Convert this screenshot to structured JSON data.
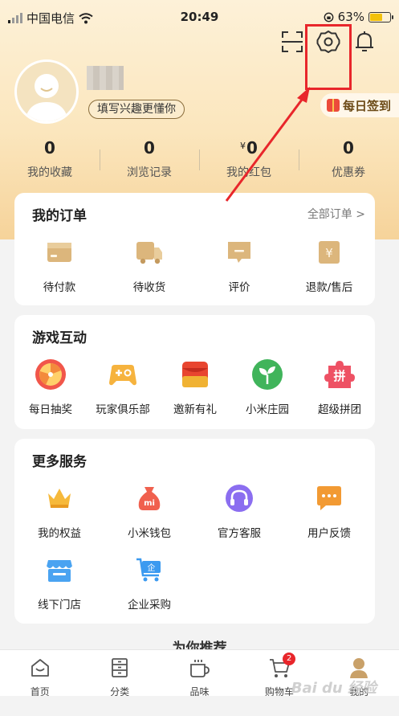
{
  "status_bar": {
    "carrier": "中国电信",
    "time": "20:49",
    "battery": "63%"
  },
  "header": {
    "interest_button": "填写兴趣更懂你",
    "daily_checkin": "每日签到",
    "icons": [
      "scan-icon",
      "settings-icon",
      "bell-icon"
    ]
  },
  "stats": [
    {
      "value": "0",
      "label": "我的收藏",
      "prefix": ""
    },
    {
      "value": "0",
      "label": "浏览记录",
      "prefix": ""
    },
    {
      "value": "0",
      "label": "我的红包",
      "prefix": "¥"
    },
    {
      "value": "0",
      "label": "优惠券",
      "prefix": ""
    }
  ],
  "orders": {
    "title": "我的订单",
    "link": "全部订单 >",
    "items": [
      "待付款",
      "待收货",
      "评价",
      "退款/售后"
    ]
  },
  "games": {
    "title": "游戏互动",
    "items": [
      "每日抽奖",
      "玩家俱乐部",
      "邀新有礼",
      "小米庄园",
      "超级拼团"
    ],
    "pin_glyph": "拼"
  },
  "services": {
    "title": "更多服务",
    "items": [
      "我的权益",
      "小米钱包",
      "官方客服",
      "用户反馈",
      "线下门店",
      "企业采购"
    ],
    "mi_glyph": "mi",
    "enterprise_glyph": "企"
  },
  "recommend_title": "为你推荐",
  "tabbar": {
    "items": [
      "首页",
      "分类",
      "品味",
      "购物车",
      "我的"
    ],
    "cart_badge": "2"
  },
  "watermark": "Bai du 经验",
  "colors": {
    "highlight": "#e8262b",
    "accent_gold": "#c9a169",
    "header_bg": "#fbe6bd"
  }
}
